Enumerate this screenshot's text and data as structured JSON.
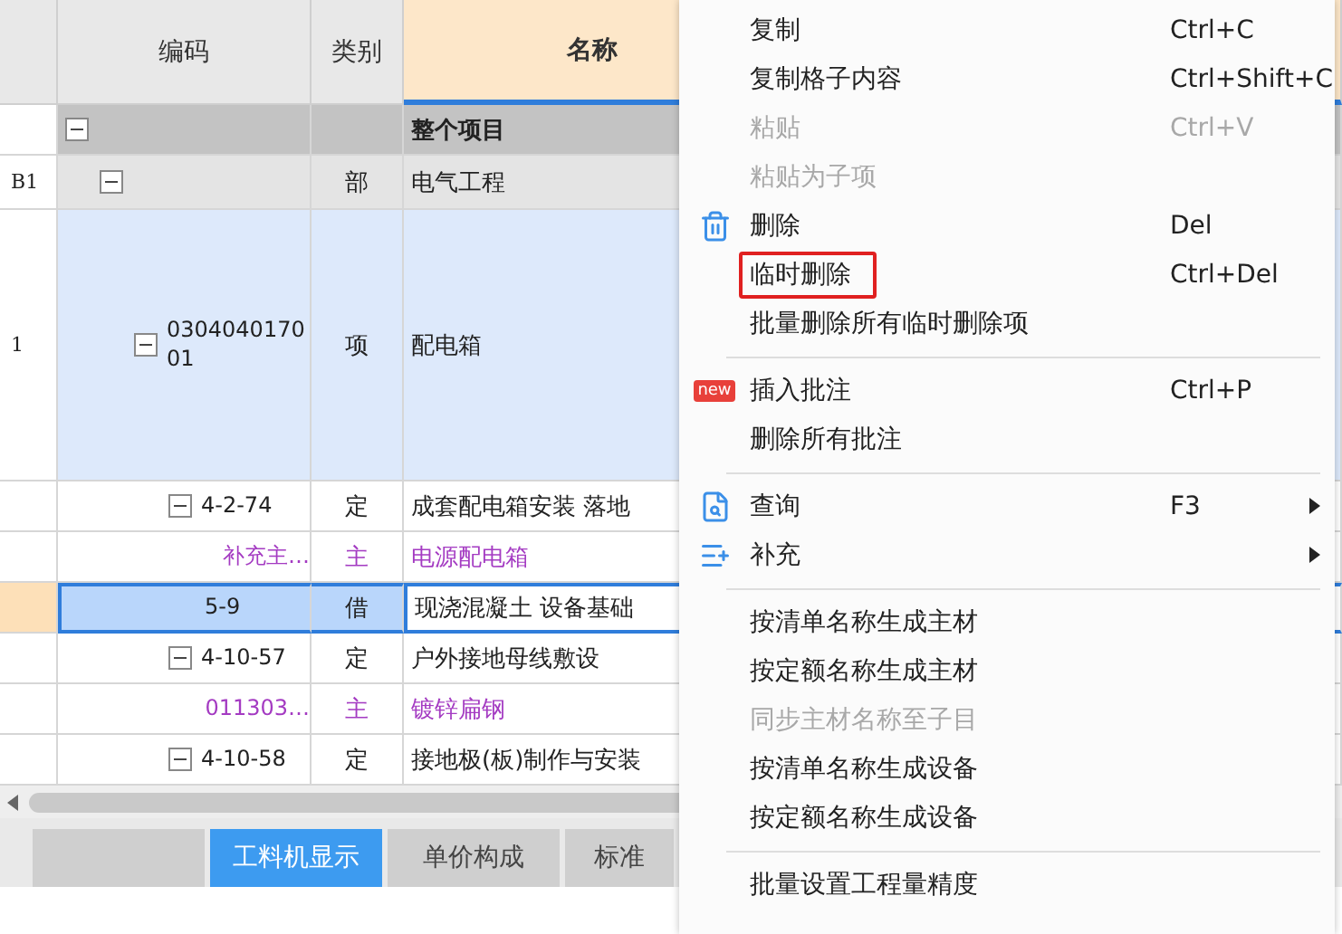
{
  "table": {
    "columns": [
      {
        "label": "编码",
        "selected": false
      },
      {
        "label": "类别",
        "selected": false
      },
      {
        "label": "名称",
        "selected": true
      }
    ],
    "rows": [
      {
        "name": "整个项目",
        "kind": "root",
        "expanded": true,
        "selected": false,
        "children": [
          {
            "num": "B1",
            "type": "部",
            "name": "电气工程",
            "kind": "part",
            "expanded": true,
            "selected": false,
            "children": [
              {
                "num": "1",
                "code": "030404017001",
                "type": "项",
                "name": "配电箱",
                "kind": "item",
                "expanded": true,
                "selected": false,
                "children": [
                  {
                    "code": "4-2-74",
                    "type": "定",
                    "name": "成套配电箱安装 落地",
                    "kind": "quota",
                    "expanded": true,
                    "selected": false,
                    "children": [
                      {
                        "code": "补充主…",
                        "type": "主",
                        "name": "电源配电箱",
                        "kind": "material",
                        "selected": false
                      }
                    ]
                  },
                  {
                    "code": "5-9",
                    "type": "借",
                    "name": "现浇混凝土 设备基础",
                    "kind": "quota",
                    "expanded": false,
                    "selected": true
                  },
                  {
                    "code": "4-10-57",
                    "type": "定",
                    "name": "户外接地母线敷设",
                    "kind": "quota",
                    "expanded": true,
                    "selected": false,
                    "children": [
                      {
                        "code": "011303…",
                        "type": "主",
                        "name": "镀锌扁钢",
                        "kind": "material",
                        "selected": false
                      }
                    ]
                  },
                  {
                    "code": "4-10-58",
                    "type": "定",
                    "name": "接地极(板)制作与安装",
                    "kind": "quota",
                    "expanded": true,
                    "selected": false
                  }
                ]
              }
            ]
          }
        ]
      }
    ]
  },
  "bottom_tabs": [
    {
      "selected": false
    },
    {
      "label": "工料机显示",
      "selected": true
    },
    {
      "label": "单价构成",
      "selected": false
    },
    {
      "label": "标准",
      "selected": false
    }
  ],
  "context_menu": [
    {
      "kind": "item",
      "label": "复制",
      "shortcut": "Ctrl+C",
      "disabled": false
    },
    {
      "kind": "item",
      "label": "复制格子内容",
      "shortcut": "Ctrl+Shift+C",
      "disabled": false
    },
    {
      "kind": "item",
      "label": "粘贴",
      "shortcut": "Ctrl+V",
      "disabled": true
    },
    {
      "kind": "item",
      "label": "粘贴为子项",
      "disabled": true
    },
    {
      "kind": "item",
      "label": "删除",
      "shortcut": "Del",
      "disabled": false
    },
    {
      "kind": "item",
      "label": "临时删除",
      "shortcut": "Ctrl+Del",
      "disabled": false,
      "highlighted": true
    },
    {
      "kind": "item",
      "label": "批量删除所有临时删除项",
      "disabled": false
    },
    {
      "kind": "separator"
    },
    {
      "kind": "item",
      "label": "插入批注",
      "shortcut": "Ctrl+P",
      "badge": "new",
      "disabled": false
    },
    {
      "kind": "item",
      "label": "删除所有批注",
      "disabled": false
    },
    {
      "kind": "separator"
    },
    {
      "kind": "item",
      "label": "查询",
      "shortcut": "F3",
      "submenu": true,
      "disabled": false
    },
    {
      "kind": "item",
      "label": "补充",
      "submenu": true,
      "disabled": false
    },
    {
      "kind": "separator"
    },
    {
      "kind": "item",
      "label": "按清单名称生成主材",
      "disabled": false
    },
    {
      "kind": "item",
      "label": "按定额名称生成主材",
      "disabled": false
    },
    {
      "kind": "item",
      "label": "同步主材名称至子目",
      "disabled": true
    },
    {
      "kind": "item",
      "label": "按清单名称生成设备",
      "disabled": false
    },
    {
      "kind": "item",
      "label": "按定额名称生成设备",
      "disabled": false
    },
    {
      "kind": "separator"
    },
    {
      "kind": "item",
      "label": "批量设置工程量精度",
      "disabled": false
    }
  ]
}
